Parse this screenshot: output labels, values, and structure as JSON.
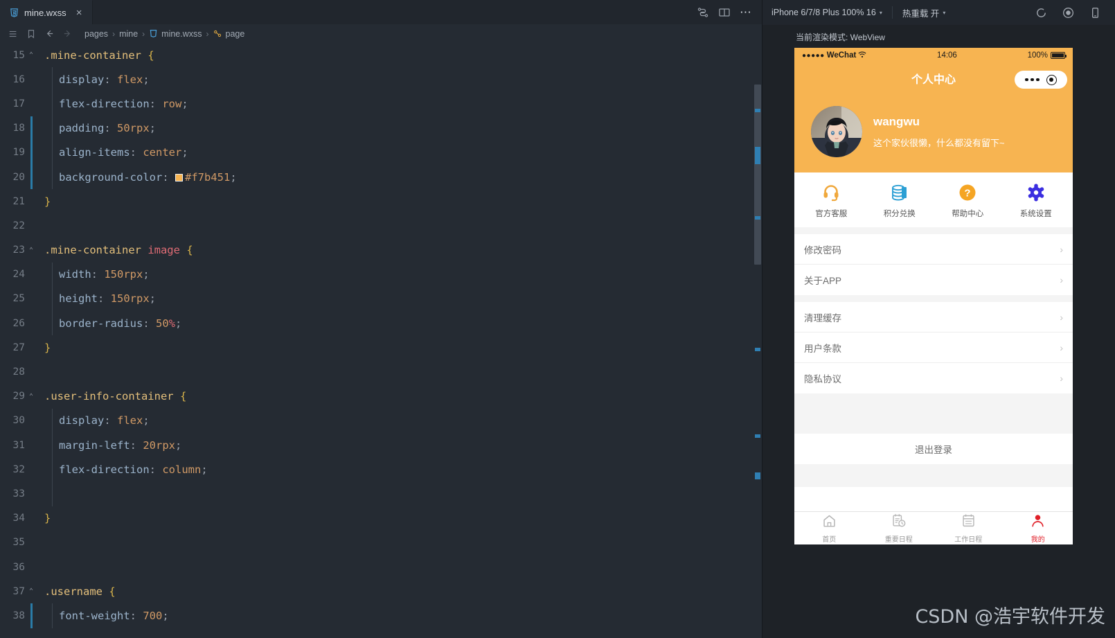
{
  "editor": {
    "tab": {
      "label": "mine.wxss",
      "icon": "wxss-file-icon",
      "close": "×"
    },
    "tab_actions": [
      {
        "name": "compile-refresh-icon"
      },
      {
        "name": "split-editor-icon"
      },
      {
        "name": "more-actions-icon",
        "label": "⋯"
      }
    ],
    "breadcrumb": {
      "menu_icon": "list-menu-icon",
      "bookmark_icon": "bookmark-icon",
      "back_icon": "arrow-left-icon",
      "forward_icon": "arrow-right-icon",
      "separator": "›",
      "items": [
        "pages",
        "mine",
        "mine.wxss",
        "page"
      ]
    },
    "code_lines": [
      {
        "num": "15",
        "fold": "⌃",
        "indent": 0,
        "active": false,
        "guide": false,
        "tokens": [
          {
            "t": ".mine-container ",
            "c": "t-sel"
          },
          {
            "t": "{",
            "c": "t-brace"
          }
        ]
      },
      {
        "num": "16",
        "fold": "",
        "indent": 1,
        "active": false,
        "guide": true,
        "tokens": [
          {
            "t": "display",
            "c": "t-prop"
          },
          {
            "t": ": ",
            "c": "t-punct"
          },
          {
            "t": "flex",
            "c": "t-val"
          },
          {
            "t": ";",
            "c": "t-punct"
          }
        ]
      },
      {
        "num": "17",
        "fold": "",
        "indent": 1,
        "active": false,
        "guide": true,
        "tokens": [
          {
            "t": "flex-direction",
            "c": "t-prop"
          },
          {
            "t": ": ",
            "c": "t-punct"
          },
          {
            "t": "row",
            "c": "t-val"
          },
          {
            "t": ";",
            "c": "t-punct"
          }
        ]
      },
      {
        "num": "18",
        "fold": "",
        "indent": 1,
        "active": true,
        "guide": true,
        "tokens": [
          {
            "t": "padding",
            "c": "t-prop"
          },
          {
            "t": ": ",
            "c": "t-punct"
          },
          {
            "t": "50rpx",
            "c": "t-val"
          },
          {
            "t": ";",
            "c": "t-punct"
          }
        ]
      },
      {
        "num": "19",
        "fold": "",
        "indent": 1,
        "active": true,
        "guide": true,
        "tokens": [
          {
            "t": "align-items",
            "c": "t-prop"
          },
          {
            "t": ": ",
            "c": "t-punct"
          },
          {
            "t": "center",
            "c": "t-val"
          },
          {
            "t": ";",
            "c": "t-punct"
          }
        ]
      },
      {
        "num": "20",
        "fold": "",
        "indent": 1,
        "active": true,
        "guide": true,
        "swatch": "#f7b451",
        "tokens": [
          {
            "t": "background-color",
            "c": "t-prop"
          },
          {
            "t": ": ",
            "c": "t-punct"
          },
          {
            "t": "#f7b451",
            "c": "t-val"
          },
          {
            "t": ";",
            "c": "t-punct"
          }
        ]
      },
      {
        "num": "21",
        "fold": "",
        "indent": 0,
        "active": false,
        "guide": false,
        "tokens": [
          {
            "t": "}",
            "c": "t-brace"
          }
        ]
      },
      {
        "num": "22",
        "fold": "",
        "indent": 0,
        "active": false,
        "guide": false,
        "tokens": []
      },
      {
        "num": "23",
        "fold": "⌃",
        "indent": 0,
        "active": false,
        "guide": false,
        "tokens": [
          {
            "t": ".mine-container ",
            "c": "t-sel"
          },
          {
            "t": "image",
            "c": "t-tag"
          },
          {
            "t": " ",
            "c": "t-punct"
          },
          {
            "t": "{",
            "c": "t-brace"
          }
        ]
      },
      {
        "num": "24",
        "fold": "",
        "indent": 1,
        "active": false,
        "guide": true,
        "tokens": [
          {
            "t": "width",
            "c": "t-prop"
          },
          {
            "t": ": ",
            "c": "t-punct"
          },
          {
            "t": "150rpx",
            "c": "t-val"
          },
          {
            "t": ";",
            "c": "t-punct"
          }
        ]
      },
      {
        "num": "25",
        "fold": "",
        "indent": 1,
        "active": false,
        "guide": true,
        "tokens": [
          {
            "t": "height",
            "c": "t-prop"
          },
          {
            "t": ": ",
            "c": "t-punct"
          },
          {
            "t": "150rpx",
            "c": "t-val"
          },
          {
            "t": ";",
            "c": "t-punct"
          }
        ]
      },
      {
        "num": "26",
        "fold": "",
        "indent": 1,
        "active": false,
        "guide": true,
        "tokens": [
          {
            "t": "border-radius",
            "c": "t-prop"
          },
          {
            "t": ": ",
            "c": "t-punct"
          },
          {
            "t": "50",
            "c": "t-val"
          },
          {
            "t": "%",
            "c": "t-tag"
          },
          {
            "t": ";",
            "c": "t-punct"
          }
        ]
      },
      {
        "num": "27",
        "fold": "",
        "indent": 0,
        "active": false,
        "guide": false,
        "tokens": [
          {
            "t": "}",
            "c": "t-brace"
          }
        ]
      },
      {
        "num": "28",
        "fold": "",
        "indent": 0,
        "active": false,
        "guide": false,
        "tokens": []
      },
      {
        "num": "29",
        "fold": "⌃",
        "indent": 0,
        "active": false,
        "guide": false,
        "tokens": [
          {
            "t": ".user-info-container ",
            "c": "t-sel"
          },
          {
            "t": "{",
            "c": "t-brace"
          }
        ]
      },
      {
        "num": "30",
        "fold": "",
        "indent": 1,
        "active": false,
        "guide": true,
        "tokens": [
          {
            "t": "display",
            "c": "t-prop"
          },
          {
            "t": ": ",
            "c": "t-punct"
          },
          {
            "t": "flex",
            "c": "t-val"
          },
          {
            "t": ";",
            "c": "t-punct"
          }
        ]
      },
      {
        "num": "31",
        "fold": "",
        "indent": 1,
        "active": false,
        "guide": true,
        "tokens": [
          {
            "t": "margin-left",
            "c": "t-prop"
          },
          {
            "t": ": ",
            "c": "t-punct"
          },
          {
            "t": "20rpx",
            "c": "t-val"
          },
          {
            "t": ";",
            "c": "t-punct"
          }
        ]
      },
      {
        "num": "32",
        "fold": "",
        "indent": 1,
        "active": false,
        "guide": true,
        "tokens": [
          {
            "t": "flex-direction",
            "c": "t-prop"
          },
          {
            "t": ": ",
            "c": "t-punct"
          },
          {
            "t": "column",
            "c": "t-val"
          },
          {
            "t": ";",
            "c": "t-punct"
          }
        ]
      },
      {
        "num": "33",
        "fold": "",
        "indent": 1,
        "active": false,
        "guide": true,
        "tokens": []
      },
      {
        "num": "34",
        "fold": "",
        "indent": 0,
        "active": false,
        "guide": false,
        "tokens": [
          {
            "t": "}",
            "c": "t-brace"
          }
        ]
      },
      {
        "num": "35",
        "fold": "",
        "indent": 0,
        "active": false,
        "guide": false,
        "tokens": []
      },
      {
        "num": "36",
        "fold": "",
        "indent": 0,
        "active": false,
        "guide": false,
        "tokens": []
      },
      {
        "num": "37",
        "fold": "⌃",
        "indent": 0,
        "active": false,
        "guide": false,
        "tokens": [
          {
            "t": ".username ",
            "c": "t-sel"
          },
          {
            "t": "{",
            "c": "t-brace"
          }
        ]
      },
      {
        "num": "38",
        "fold": "",
        "indent": 1,
        "active": true,
        "guide": true,
        "tokens": [
          {
            "t": "font-weight",
            "c": "t-prop"
          },
          {
            "t": ": ",
            "c": "t-punct"
          },
          {
            "t": "700",
            "c": "t-val"
          },
          {
            "t": ";",
            "c": "t-punct"
          }
        ]
      }
    ]
  },
  "simulator": {
    "toolbar": {
      "device": "iPhone 6/7/8 Plus 100% 16",
      "hot_reload": "热重载 开",
      "caret": "▾",
      "icons": [
        {
          "name": "refresh-icon"
        },
        {
          "name": "record-icon"
        },
        {
          "name": "device-toggle-icon"
        }
      ]
    },
    "render_mode": "当前渲染模式: WebView"
  },
  "phone": {
    "status_bar": {
      "carrier": "WeChat",
      "dots": "●●●●●",
      "time": "14:06",
      "battery_text": "100%",
      "battery_level": 100
    },
    "nav": {
      "title": "个人中心"
    },
    "profile": {
      "username": "wangwu",
      "signature": "这个家伙很懒，什么都没有留下~",
      "avatar_alt": "user-avatar"
    },
    "grid": [
      {
        "label": "官方客服",
        "icon": "headset-icon",
        "color": "#f0a83c"
      },
      {
        "label": "积分兑换",
        "icon": "coins-stack-icon",
        "color": "#2b9fd4"
      },
      {
        "label": "帮助中心",
        "icon": "question-circle-icon",
        "color": "#f5a524"
      },
      {
        "label": "系统设置",
        "icon": "gear-icon",
        "color": "#3b2ee0"
      }
    ],
    "menu_group_a": [
      {
        "label": "修改密码"
      },
      {
        "label": "关于APP"
      }
    ],
    "menu_group_b": [
      {
        "label": "清理缓存"
      },
      {
        "label": "用户条款"
      },
      {
        "label": "隐私协议"
      }
    ],
    "chevron": "›",
    "logout": "退出登录",
    "tabs": [
      {
        "label": "首页",
        "icon": "home-icon",
        "active": false
      },
      {
        "label": "重要日程",
        "icon": "schedule-clock-icon",
        "active": false
      },
      {
        "label": "工作日程",
        "icon": "calendar-icon",
        "active": false
      },
      {
        "label": "我的",
        "icon": "user-icon",
        "active": true
      }
    ]
  },
  "watermark": "CSDN @浩宇软件开发",
  "colors": {
    "brand": "#f7b451",
    "active_tab": "#e01f28",
    "editor_bg": "#252b33"
  }
}
